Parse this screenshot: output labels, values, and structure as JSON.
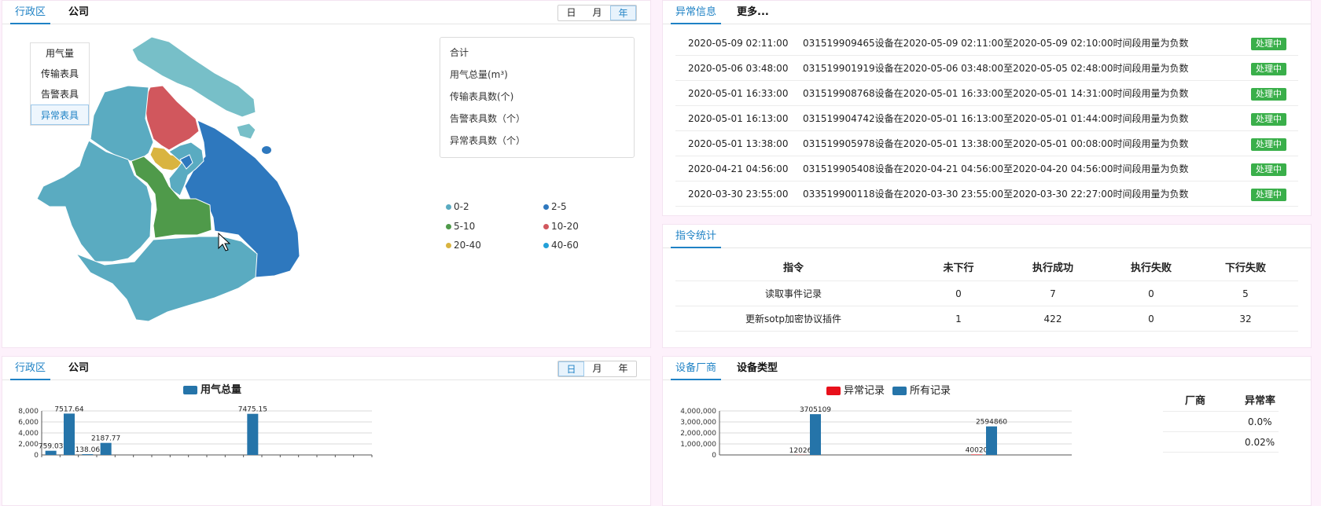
{
  "map_panel": {
    "tabs": [
      "行政区",
      "公司"
    ],
    "periods": [
      "日",
      "月",
      "年"
    ],
    "active_period": "年",
    "layers": [
      "用气量",
      "传输表具",
      "告警表具",
      "异常表具"
    ],
    "active_layer": "异常表具",
    "summary": [
      "合计",
      "用气总量(m³)",
      "传输表具数(个)",
      "告警表具数（个）",
      "异常表具数（个）"
    ],
    "legend": [
      {
        "label": "0-2",
        "color": "#5aabc1"
      },
      {
        "label": "2-5",
        "color": "#2e78be"
      },
      {
        "label": "5-10",
        "color": "#4f9a4a"
      },
      {
        "label": "10-20",
        "color": "#d1575d"
      },
      {
        "label": "20-40",
        "color": "#d9b440"
      },
      {
        "label": "40-60",
        "color": "#23a0d8"
      }
    ]
  },
  "alarm_panel": {
    "tabs": [
      "异常信息",
      "更多..."
    ],
    "rows": [
      {
        "time": "2020-05-09 02:11:00",
        "message": "031519909465设备在2020-05-09 02:11:00至2020-05-09 02:10:00时间段用量为负数",
        "status": "处理中"
      },
      {
        "time": "2020-05-06 03:48:00",
        "message": "031519901919设备在2020-05-06 03:48:00至2020-05-05 02:48:00时间段用量为负数",
        "status": "处理中"
      },
      {
        "time": "2020-05-01 16:33:00",
        "message": "031519908768设备在2020-05-01 16:33:00至2020-05-01 14:31:00时间段用量为负数",
        "status": "处理中"
      },
      {
        "time": "2020-05-01 16:13:00",
        "message": "031519904742设备在2020-05-01 16:13:00至2020-05-01 01:44:00时间段用量为负数",
        "status": "处理中"
      },
      {
        "time": "2020-05-01 13:38:00",
        "message": "031519905978设备在2020-05-01 13:38:00至2020-05-01 00:08:00时间段用量为负数",
        "status": "处理中"
      },
      {
        "time": "2020-04-21 04:56:00",
        "message": "031519905408设备在2020-04-21 04:56:00至2020-04-20 04:56:00时间段用量为负数",
        "status": "处理中"
      },
      {
        "time": "2020-03-30 23:55:00",
        "message": "033519900118设备在2020-03-30 23:55:00至2020-03-30 22:27:00时间段用量为负数",
        "status": "处理中"
      }
    ]
  },
  "command_panel": {
    "tab": "指令统计",
    "headers": [
      "指令",
      "未下行",
      "执行成功",
      "执行失败",
      "下行失败"
    ],
    "rows": [
      [
        "读取事件记录",
        "0",
        "7",
        "0",
        "5"
      ],
      [
        "更新sotp加密协议插件",
        "1",
        "422",
        "0",
        "32"
      ]
    ]
  },
  "usage_panel": {
    "tabs": [
      "行政区",
      "公司"
    ],
    "periods": [
      "日",
      "月",
      "年"
    ],
    "active_period": "日"
  },
  "vendor_panel": {
    "tabs": [
      "设备厂商",
      "设备类型"
    ],
    "table_headers": [
      "厂商",
      "异常率"
    ],
    "table_rows": [
      [
        "",
        "0.0%"
      ],
      [
        "",
        "0.02%"
      ]
    ]
  },
  "chart_data": [
    {
      "type": "bar",
      "legend": [
        "用气总量"
      ],
      "series": [
        {
          "name": "用气总量",
          "color": "#2574a9",
          "values": [
            759.03,
            7517.64,
            138.06,
            2187.77,
            0,
            0,
            0,
            0,
            0,
            0,
            0,
            7475.15,
            0,
            0,
            0,
            0,
            0,
            0
          ]
        }
      ],
      "value_labels": [
        "759.03",
        "7517.64",
        "138.06",
        "2187.77",
        "",
        "",
        "",
        "",
        "",
        "",
        "",
        "7475.15",
        "",
        "",
        "",
        "",
        "",
        ""
      ],
      "yticks": [
        "8,000",
        "6,000",
        "4,000",
        "2,000",
        "0"
      ],
      "ylim": [
        0,
        8000
      ]
    },
    {
      "type": "bar",
      "legend": [
        "异常记录",
        "所有记录"
      ],
      "categories": [
        "",
        ""
      ],
      "series": [
        {
          "name": "异常记录",
          "color": "#e8101b",
          "values": [
            12026,
            40020
          ]
        },
        {
          "name": "所有记录",
          "color": "#2574a9",
          "values": [
            3705109,
            2594860
          ]
        }
      ],
      "value_labels": [
        [
          "12026",
          "40020"
        ],
        [
          "3705109",
          "2594860"
        ]
      ],
      "yticks": [
        "4,000,000",
        "3,000,000",
        "2,000,000",
        "1,000,000",
        "0"
      ],
      "ylim": [
        0,
        4000000
      ]
    }
  ]
}
